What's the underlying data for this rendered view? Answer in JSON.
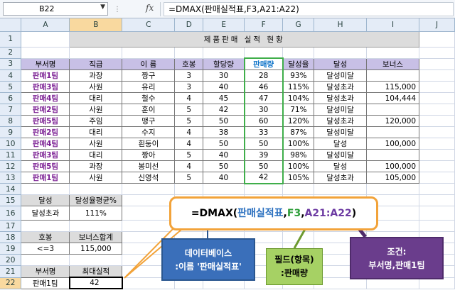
{
  "formula_bar": {
    "name_box": "B22",
    "fx_label": "fx",
    "formula": "=DMAX(판매실적표,F3,A21:A22)"
  },
  "columns": [
    "A",
    "B",
    "C",
    "D",
    "E",
    "F",
    "G",
    "H",
    "I",
    "J"
  ],
  "rows": [
    "1",
    "2",
    "3",
    "4",
    "5",
    "6",
    "7",
    "8",
    "9",
    "10",
    "11",
    "12",
    "13",
    "14",
    "15",
    "16",
    "17",
    "18",
    "19",
    "20",
    "21",
    "22"
  ],
  "sheet": {
    "title": "제품판매 실적 현황",
    "headers": [
      "부서명",
      "직급",
      "이 름",
      "호봉",
      "할당량",
      "판매량",
      "달성율",
      "달성",
      "보너스"
    ],
    "records": [
      [
        "판매1팀",
        "과장",
        "짱구",
        "3",
        "30",
        "28",
        "93%",
        "달성미달",
        ""
      ],
      [
        "판매3팀",
        "사원",
        "유리",
        "3",
        "40",
        "46",
        "115%",
        "달성초과",
        "115,000"
      ],
      [
        "판매4팀",
        "대리",
        "철수",
        "4",
        "45",
        "47",
        "104%",
        "달성초과",
        "104,444"
      ],
      [
        "판매2팀",
        "사원",
        "훈이",
        "5",
        "42",
        "30",
        "71%",
        "달성미달",
        ""
      ],
      [
        "판매5팀",
        "주임",
        "맹구",
        "5",
        "50",
        "60",
        "120%",
        "달성초과",
        "120,000"
      ],
      [
        "판매2팀",
        "대리",
        "수지",
        "4",
        "38",
        "33",
        "87%",
        "달성미달",
        ""
      ],
      [
        "판매4팀",
        "사원",
        "흰둥이",
        "4",
        "50",
        "50",
        "100%",
        "달성",
        "100,000"
      ],
      [
        "판매3팀",
        "대리",
        "짱아",
        "5",
        "40",
        "39",
        "98%",
        "달성미달",
        ""
      ],
      [
        "판매5팀",
        "과장",
        "봉미선",
        "4",
        "50",
        "50",
        "100%",
        "달성",
        "100,000"
      ],
      [
        "판매1팀",
        "사원",
        "신영석",
        "5",
        "40",
        "42",
        "105%",
        "달성초과",
        "105,000"
      ]
    ],
    "block1": {
      "h1": "달성",
      "h2": "달성율평균%",
      "v1": "달성초과",
      "v2": "111%"
    },
    "block2": {
      "h1": "호봉",
      "h2": "보너스합계",
      "v1": "<=3",
      "v2": "115,000"
    },
    "block3": {
      "h1": "부서명",
      "h2": "최대실적",
      "v1": "판매1팀",
      "v2": "42"
    }
  },
  "callouts": {
    "main_func": "=DMAX(",
    "main_db": "판매실적표",
    "main_comma1": ",",
    "main_field": "F3",
    "main_comma2": ",",
    "main_criteria": "A21:A22",
    "main_close": ")",
    "db_line1": "데이터베이스",
    "db_line2": ":이름 '판매실적표'",
    "field_line1": "필드(항목)",
    "field_line2": ":판매량",
    "cond_line1": "조건:",
    "cond_line2": "부서명,판매1팀"
  },
  "colors": {
    "dept_text": "#7b1f93",
    "header_fill": "#c8c0e6",
    "highlight_column": "#3fae4a",
    "callout_border": "#f2a33a",
    "db_box": "#3a6fba",
    "field_box": "#a6d164",
    "cond_box": "#6a3d8c"
  }
}
